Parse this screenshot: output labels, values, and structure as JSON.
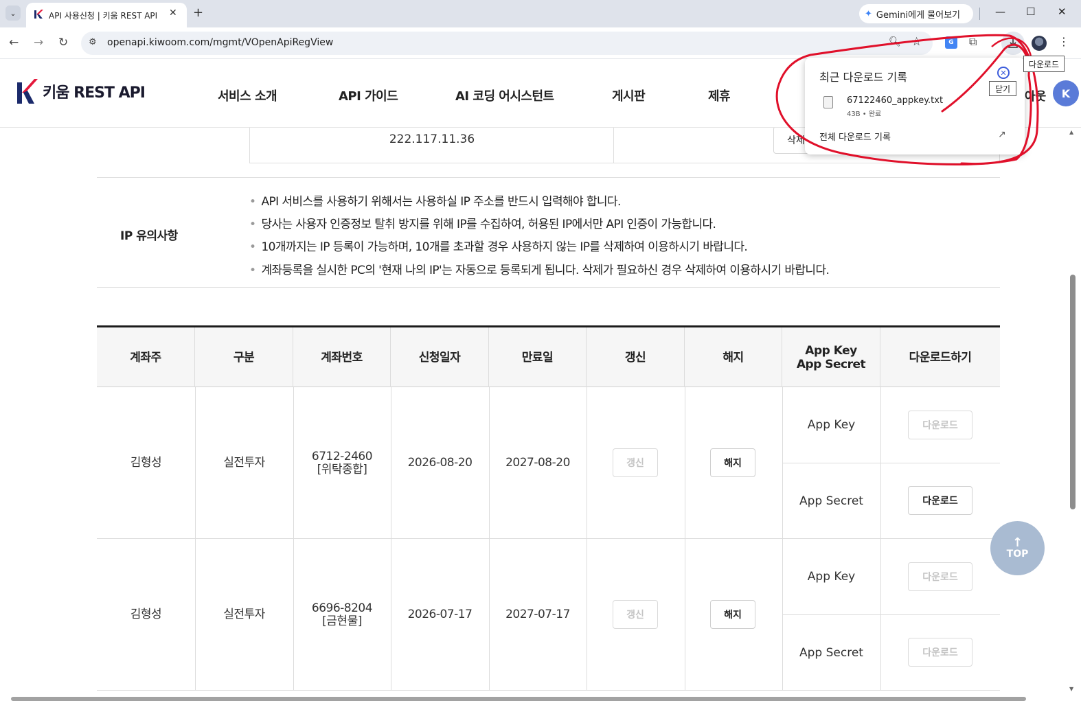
{
  "browser": {
    "tab_title": "API 사용신청 | 키움 REST API",
    "tab_close": "✕",
    "new_tab": "+",
    "gemini_label": "Gemini에게 물어보기",
    "url": "openapi.kiwoom.com/mgmt/VOpenApiRegView",
    "download_tooltip": "다운로드",
    "colors": {
      "tabstrip": "#dfe3eb",
      "omnibox": "#eef1f6"
    }
  },
  "header": {
    "logo_text": "키움 REST API",
    "nav": [
      "서비스 소개",
      "API 가이드",
      "AI 코딩 어시스턴트",
      "게시판",
      "제휴"
    ],
    "logout_partial": "아웃",
    "user_initial": "K",
    "brand_colors": {
      "k_red": "#e4183b",
      "k_navy": "#1b2a6b"
    }
  },
  "ip_table": {
    "ip_value": "222.117.11.36",
    "delete_label": "삭제"
  },
  "ip_notes": {
    "title": "IP 유의사항",
    "items": [
      "API 서비스를 사용하기 위해서는 사용하실 IP 주소를 반드시 입력해야 합니다.",
      "당사는 사용자 인증정보 탈취 방지를 위해 IP를 수집하여, 허용된 IP에서만 API 인증이 가능합니다.",
      "10개까지는 IP 등록이 가능하며, 10개를 초과할 경우 사용하지 않는 IP를 삭제하여 이용하시기 바랍니다.",
      "계좌등록을 실시한 PC의 '현재 나의 IP'는 자동으로 등록되게 됩니다. 삭제가 필요하신 경우 삭제하여 이용하시기 바랍니다."
    ]
  },
  "account_table": {
    "headers": [
      "계좌주",
      "구분",
      "계좌번호",
      "신청일자",
      "만료일",
      "갱신",
      "해지",
      "App Key",
      "App Secret",
      "다운로드하기"
    ],
    "rows": [
      {
        "owner": "김형성",
        "type": "실전투자",
        "account_no": "6712-2460",
        "account_kind": "[위탁종합]",
        "apply_date": "2026-08-20",
        "expire_date": "2027-08-20",
        "renew_label": "갱신",
        "cancel_label": "해지",
        "key_label": "App Key",
        "secret_label": "App Secret",
        "key_download_label": "다운로드",
        "secret_download_label": "다운로드"
      },
      {
        "owner": "김형성",
        "type": "실전투자",
        "account_no": "6696-8204",
        "account_kind": "[금현물]",
        "apply_date": "2026-07-17",
        "expire_date": "2027-07-17",
        "renew_label": "갱신",
        "cancel_label": "해지",
        "key_label": "App Key",
        "secret_label": "App Secret",
        "key_download_label": "다운로드",
        "secret_download_label": "다운로드"
      }
    ]
  },
  "top_button": {
    "label": "TOP",
    "color": "#a9bbd2"
  },
  "download_bubble": {
    "title": "최근 다운로드 기록",
    "close_tooltip": "닫기",
    "file_name": "67122460_appkey.txt",
    "file_meta": "43B • 완료",
    "all_history": "전체 다운로드 기록"
  },
  "annotation_color": "#e0102a"
}
